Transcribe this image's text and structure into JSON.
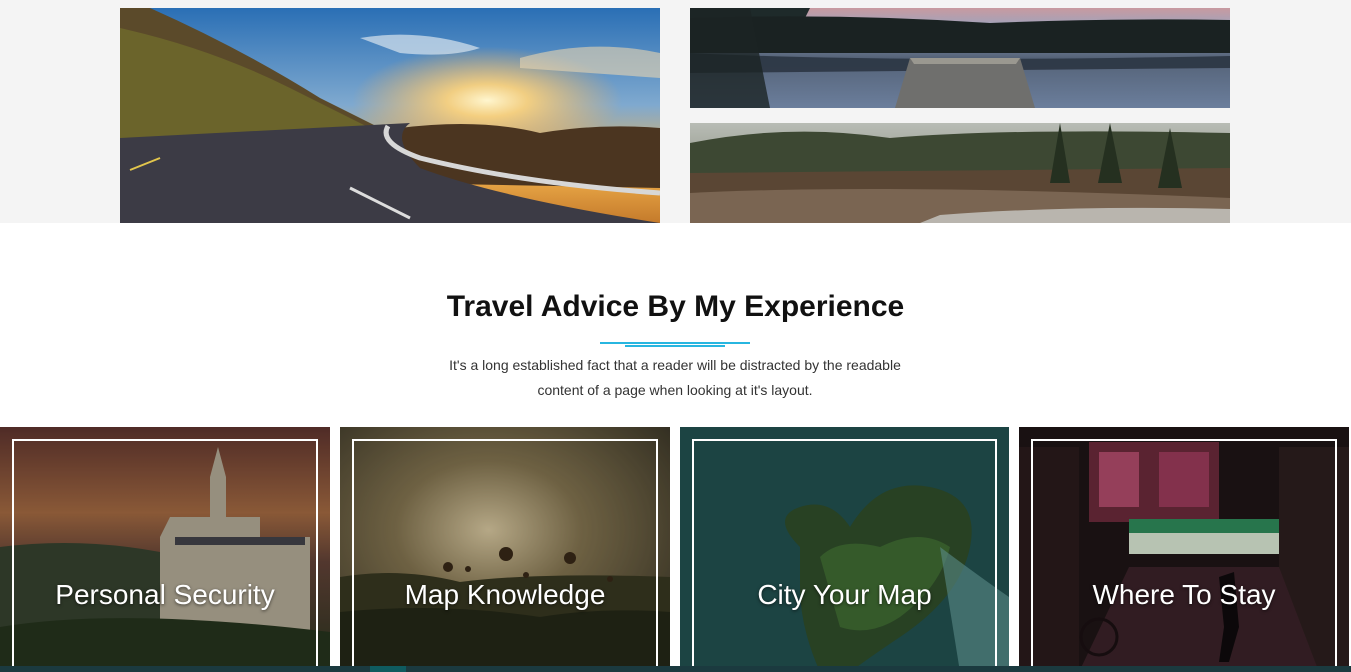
{
  "gallery": {
    "images": [
      {
        "name": "mountain-road-sunset-image"
      },
      {
        "name": "lake-dock-image"
      },
      {
        "name": "forest-river-image"
      }
    ]
  },
  "section": {
    "title": "Travel Advice By My Experience",
    "intro_line1": "It's a long established fact that a reader will be distracted by the readable",
    "intro_line2": "content of a page when looking at it's layout.",
    "accent_color": "#27b6e0"
  },
  "cards": [
    {
      "title": "Personal Security",
      "image": "castle-sunset"
    },
    {
      "title": "Map Knowledge",
      "image": "hot-air-balloons"
    },
    {
      "title": "City Your Map",
      "image": "heart-island"
    },
    {
      "title": "Where To Stay",
      "image": "night-street"
    }
  ]
}
